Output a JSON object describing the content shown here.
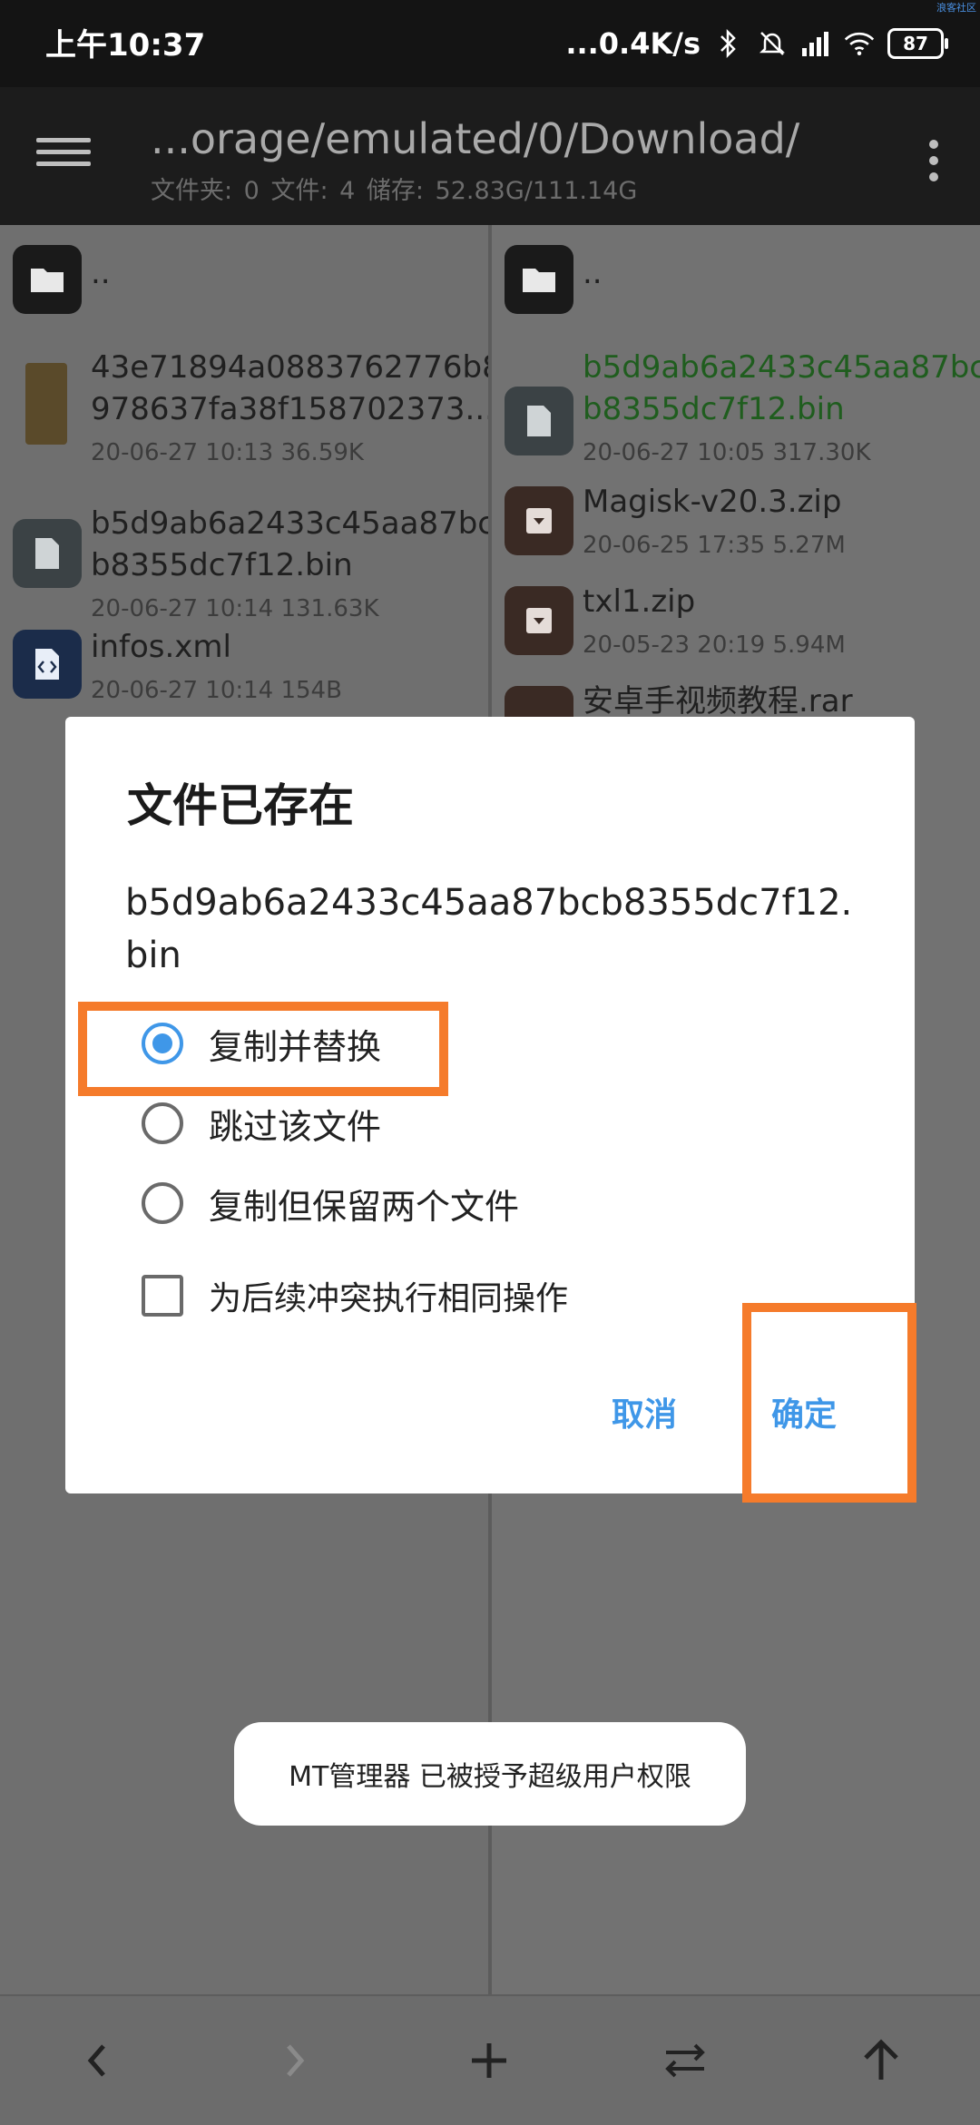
{
  "status_bar": {
    "time": "上午10:37",
    "speed": "...0.4K/s",
    "battery": "87",
    "corner": "浪客社区"
  },
  "toolbar": {
    "path": "...orage/emulated/0/Download/",
    "summary": "文件夹: 0  文件: 4  储存: 52.83G/111.14G"
  },
  "left_pane": {
    "items": [
      {
        "name": "..",
        "meta": ""
      },
      {
        "name_line1": "43e71894a0883762776b8",
        "name_line2": "978637fa38f158702373...",
        "meta": "20-06-27 10:13  36.59K"
      },
      {
        "name_line1": "b5d9ab6a2433c45aa87bc",
        "name_line2": "b8355dc7f12.bin",
        "meta": "20-06-27 10:14  131.63K"
      },
      {
        "name": "infos.xml",
        "meta": "20-06-27 10:14  154B"
      }
    ]
  },
  "right_pane": {
    "items": [
      {
        "name": "..",
        "meta": ""
      },
      {
        "name_line1": "b5d9ab6a2433c45aa87bc",
        "name_line2": "b8355dc7f12.bin",
        "meta": "20-06-27 10:05  317.30K"
      },
      {
        "name": "Magisk-v20.3.zip",
        "meta": "20-06-25 17:35  5.27M"
      },
      {
        "name": "txl1.zip",
        "meta": "20-05-23 20:19  5.94M"
      },
      {
        "name": "安卓手视频教程.rar",
        "meta": ""
      }
    ]
  },
  "dialog": {
    "title": "文件已存在",
    "filename": "b5d9ab6a2433c45aa87bcb8355dc7f12.bin",
    "options": [
      "复制并替换",
      "跳过该文件",
      "复制但保留两个文件"
    ],
    "selected_option": 0,
    "checkbox_label": "为后续冲突执行相同操作",
    "checkbox_checked": false,
    "cancel_label": "取消",
    "ok_label": "确定",
    "accent_color": "#3f97e8",
    "highlight_color": "#f57b2b"
  },
  "toast": {
    "text": "MT管理器 已被授予超级用户权限"
  },
  "bottom_bar": {
    "buttons": [
      "back-icon",
      "forward-icon",
      "add-icon",
      "swap-icon",
      "up-icon"
    ]
  }
}
